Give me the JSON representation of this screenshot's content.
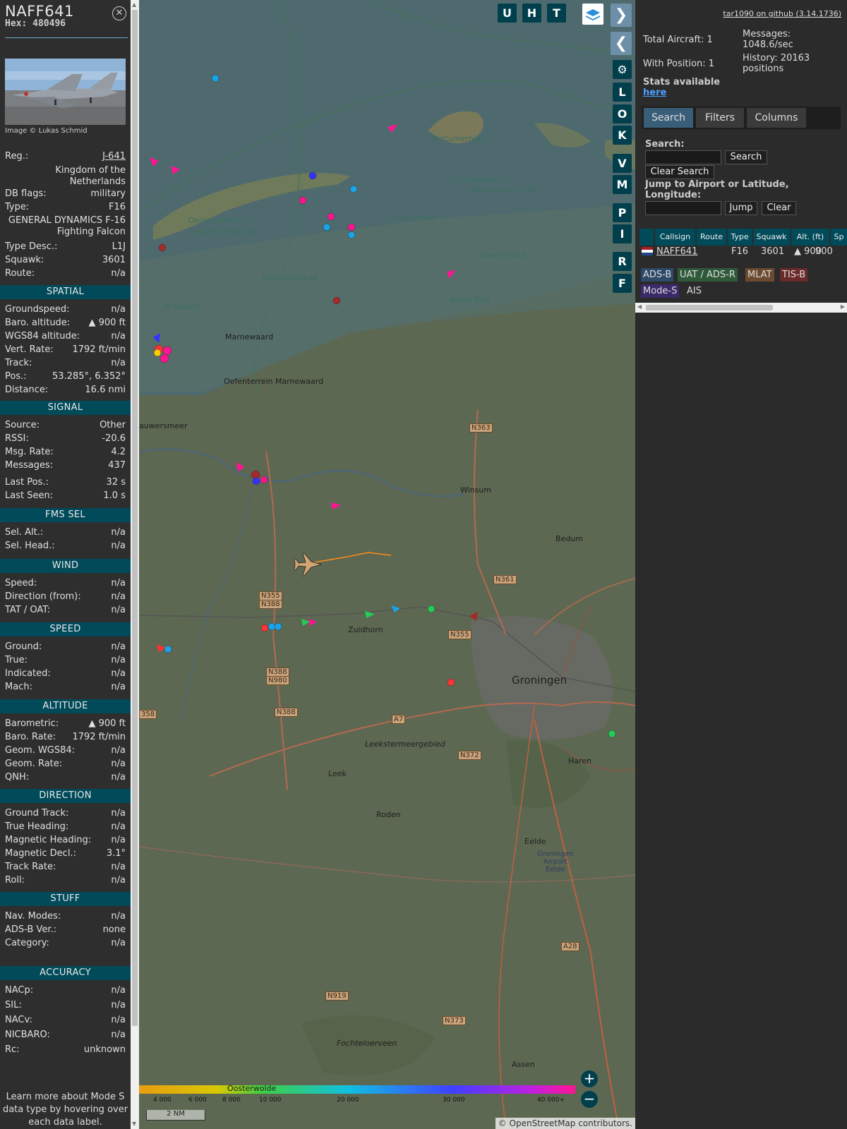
{
  "aircraft": {
    "callsign": "NAFF641",
    "hex": "Hex: 480496",
    "image_credit": "Image © Lukas Schmid",
    "close_icon": "close-icon"
  },
  "details": [
    {
      "k": "Reg.:",
      "v": "J-641"
    },
    {
      "k": "DB flags:",
      "v": "military"
    },
    {
      "k": "Type:",
      "v": "F16"
    },
    {
      "k": "Type Desc.:",
      "v": "L1J"
    },
    {
      "k": "Squawk:",
      "v": "3601"
    },
    {
      "k": "Route:",
      "v": "n/a"
    }
  ],
  "country": "Kingdom of the Netherlands",
  "type_full": "GENERAL DYNAMICS F-16 Fighting Falcon",
  "sections": {
    "spatial": {
      "title": "SPATIAL",
      "rows": [
        {
          "k": "Groundspeed:",
          "v": "n/a"
        },
        {
          "k": "Baro. altitude:",
          "v": "▲ 900 ft"
        },
        {
          "k": "WGS84 altitude:",
          "v": "n/a"
        },
        {
          "k": "Vert. Rate:",
          "v": "1792 ft/min"
        },
        {
          "k": "Track:",
          "v": "n/a"
        },
        {
          "k": "Pos.:",
          "v": "53.285°, 6.352°"
        },
        {
          "k": "Distance:",
          "v": "16.6 nmi"
        }
      ]
    },
    "signal": {
      "title": "SIGNAL",
      "rows": [
        {
          "k": "Source:",
          "v": "Other"
        },
        {
          "k": "RSSI:",
          "v": "-20.6"
        },
        {
          "k": "Msg. Rate:",
          "v": "4.2"
        },
        {
          "k": "Messages:",
          "v": "437"
        },
        {
          "k": "Last Pos.:",
          "v": "32 s"
        },
        {
          "k": "Last Seen:",
          "v": "1.0 s"
        }
      ]
    },
    "fms": {
      "title": "FMS SEL",
      "rows": [
        {
          "k": "Sel. Alt.:",
          "v": "n/a"
        },
        {
          "k": "Sel. Head.:",
          "v": "n/a"
        }
      ]
    },
    "wind": {
      "title": "WIND",
      "rows": [
        {
          "k": "Speed:",
          "v": "n/a"
        },
        {
          "k": "Direction (from):",
          "v": "n/a"
        },
        {
          "k": "TAT / OAT:",
          "v": "n/a"
        }
      ]
    },
    "speed": {
      "title": "SPEED",
      "rows": [
        {
          "k": "Ground:",
          "v": "n/a"
        },
        {
          "k": "True:",
          "v": "n/a"
        },
        {
          "k": "Indicated:",
          "v": "n/a"
        },
        {
          "k": "Mach:",
          "v": "n/a"
        }
      ]
    },
    "altitude": {
      "title": "ALTITUDE",
      "rows": [
        {
          "k": "Barometric:",
          "v": "▲ 900 ft"
        },
        {
          "k": "Baro. Rate:",
          "v": "1792 ft/min"
        },
        {
          "k": "Geom. WGS84:",
          "v": "n/a"
        },
        {
          "k": "Geom. Rate:",
          "v": "n/a"
        },
        {
          "k": "QNH:",
          "v": "n/a"
        }
      ]
    },
    "direction": {
      "title": "DIRECTION",
      "rows": [
        {
          "k": "Ground Track:",
          "v": "n/a"
        },
        {
          "k": "True Heading:",
          "v": "n/a"
        },
        {
          "k": "Magnetic Heading:",
          "v": "n/a"
        },
        {
          "k": "Magnetic Decl.:",
          "v": "3.1°"
        },
        {
          "k": "Track Rate:",
          "v": "n/a"
        },
        {
          "k": "Roll:",
          "v": "n/a"
        }
      ]
    },
    "stuff": {
      "title": "STUFF",
      "rows": [
        {
          "k": "Nav. Modes:",
          "v": "n/a"
        },
        {
          "k": "ADS-B Ver.:",
          "v": "none"
        },
        {
          "k": "Category:",
          "v": "n/a"
        }
      ]
    },
    "accuracy": {
      "title": "ACCURACY",
      "rows": [
        {
          "k": "NACp:",
          "v": "n/a"
        },
        {
          "k": "SIL:",
          "v": "n/a"
        },
        {
          "k": "NACv:",
          "v": "n/a"
        },
        {
          "k": "NICBARO:",
          "v": "n/a"
        },
        {
          "k": "Rc:",
          "v": "unknown"
        }
      ]
    }
  },
  "learn_more": "Learn more about Mode S data type by hovering over each data label.",
  "map": {
    "top_buttons": [
      "U",
      "H",
      "T"
    ],
    "side_buttons": [
      "L",
      "O",
      "K",
      "V",
      "M",
      "P",
      "I",
      "R",
      "F"
    ],
    "attribution": "© OpenStreetMap contributors.",
    "scale": "2 NM",
    "zoom_in": "+",
    "zoom_out": "−",
    "altitude_legend": [
      "4 000",
      "6 000",
      "8 000",
      "10 000",
      "20 000",
      "30 000",
      "40 000+"
    ],
    "labels": [
      "Rottumerplaat",
      "Uithuizerwad",
      "Boschwad-Schild",
      "Schiermonnikoog",
      "Oosterkwelder",
      "Groningerwad",
      "Lauwerswad",
      "Brakrand",
      "Marnewaard",
      "Oefenterrein Marnewaard",
      "Winsum",
      "Bedum",
      "Zuidhorn",
      "Groningen",
      "Haren",
      "Leek",
      "Roden",
      "Eelde",
      "Groningen Airport Eelde",
      "Leekstermeergebied",
      "Fochteloerveen",
      "Oosterwolde",
      "Assen",
      "Andel Bult",
      "auwersmeer",
      "Boschwad"
    ],
    "road_labels": [
      "N363",
      "N361",
      "N355",
      "N388",
      "N355",
      "N388",
      "N980",
      "N388",
      "A7",
      "N372",
      "N919",
      "N373",
      "A28",
      "358"
    ]
  },
  "right": {
    "github": "tar1090 on github (3.14.1736)",
    "total_aircraft": "Total Aircraft: 1",
    "with_position": "With Position: 1",
    "messages": "Messages: 1048.6/sec",
    "history": "History: 20163 positions",
    "stats": "Stats available",
    "here": "here",
    "tabs": [
      "Search",
      "Filters",
      "Columns"
    ],
    "search_label": "Search:",
    "search_btn": "Search",
    "clear_search_btn": "Clear Search",
    "jump_label": "Jump to Airport or Latitude, Longitude:",
    "jump_btn": "Jump",
    "clear_btn": "Clear",
    "columns": [
      "Callsign",
      "Route",
      "Type",
      "Squawk",
      "Alt. (ft)",
      "Sp"
    ],
    "row": {
      "callsign": "NAFF641",
      "route": "",
      "type": "F16",
      "squawk": "3601",
      "alt": "▲ 900"
    },
    "sources": [
      "ADS-B",
      "UAT / ADS-R",
      "MLAT",
      "TIS-B",
      "Mode-S",
      "AIS"
    ]
  }
}
